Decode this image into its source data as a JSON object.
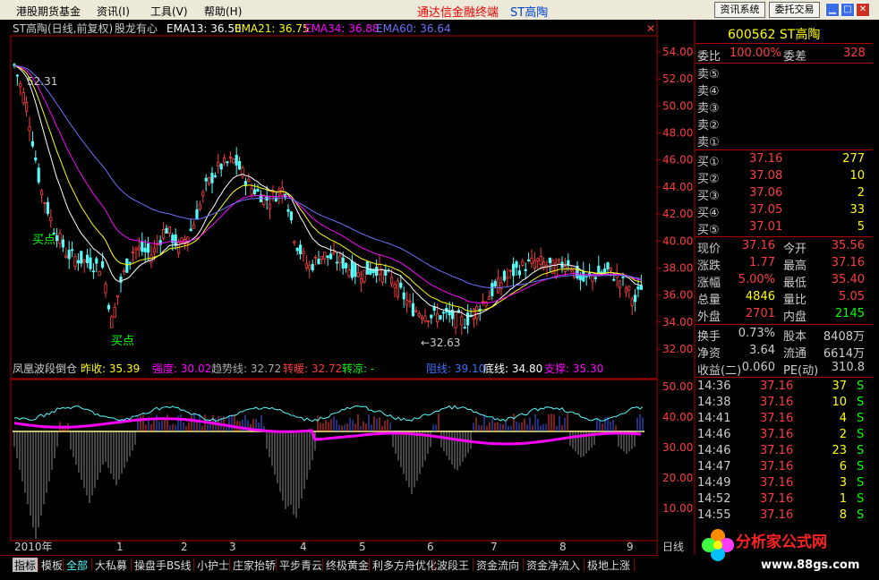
{
  "menu": {
    "items": [
      "港股期货基金",
      "资讯(I)",
      "工具(V)",
      "帮助(H)"
    ],
    "title": "通达信金融终端",
    "stock_title": "ST高陶",
    "btn_news": "资讯系统",
    "btn_trade": "委托交易"
  },
  "main_chart": {
    "header_name": "ST高陶(日线,前复权)",
    "indicator_name": "股龙有心",
    "ema13": "EMA13: 36.50",
    "ema21": "EMA21: 36.75",
    "ema34": "EMA34: 36.88",
    "ema60": "EMA60: 36.64",
    "high_label": "52.31",
    "low_label": "←32.63",
    "buy_label": "买点",
    "price_ticks": [
      "54.00",
      "52.00",
      "50.00",
      "48.00",
      "46.00",
      "44.00",
      "42.00",
      "40.00",
      "38.00",
      "36.00",
      "34.00",
      "32.00"
    ]
  },
  "sub_chart": {
    "name": "凤凰波段倒仓",
    "prev_close": "昨收: 35.39",
    "strength": "强度: 30.02",
    "trend": "趋势线: 32.72",
    "warm": "转暖: 32.72",
    "cool": "转凉: -",
    "pressure": "阻线: 39.10",
    "bottom": "底线: 34.80",
    "support": "支撑: 35.30",
    "ticks": [
      "50.00",
      "40.00",
      "30.00",
      "20.00",
      "10.00"
    ]
  },
  "time_axis": {
    "year": "2010年",
    "months": [
      "1",
      "2",
      "3",
      "4",
      "5",
      "6",
      "7",
      "8",
      "9"
    ],
    "period": "日线"
  },
  "quote": {
    "code_name": "600562 ST高陶",
    "weibi_label": "委比",
    "weibi": "100.00%",
    "weicha_label": "委差",
    "weicha": "328",
    "sells": [
      "卖⑤",
      "卖④",
      "卖③",
      "卖②",
      "卖①"
    ],
    "buys": [
      {
        "label": "买①",
        "price": "37.16",
        "vol": "277"
      },
      {
        "label": "买②",
        "price": "37.08",
        "vol": "10"
      },
      {
        "label": "买③",
        "price": "37.06",
        "vol": "2"
      },
      {
        "label": "买④",
        "price": "37.05",
        "vol": "33"
      },
      {
        "label": "买⑤",
        "price": "37.01",
        "vol": "5"
      }
    ],
    "stats": [
      {
        "l1": "现价",
        "v1": "37.16",
        "l2": "今开",
        "v2": "35.56"
      },
      {
        "l1": "涨跌",
        "v1": "1.77",
        "l2": "最高",
        "v2": "37.16"
      },
      {
        "l1": "涨幅",
        "v1": "5.00%",
        "l2": "最低",
        "v2": "35.40"
      },
      {
        "l1": "总量",
        "v1": "4846",
        "l2": "量比",
        "v2": "5.05"
      },
      {
        "l1": "外盘",
        "v1": "2701",
        "l2": "内盘",
        "v2": "2145"
      }
    ],
    "fund": [
      {
        "l1": "换手",
        "v1": "0.73%",
        "l2": "股本",
        "v2": "8408万"
      },
      {
        "l1": "净资",
        "v1": "3.64",
        "l2": "流通",
        "v2": "6614万"
      },
      {
        "l1": "收益(二)",
        "v1": "0.060",
        "l2": "PE(动)",
        "v2": "310.8"
      }
    ],
    "ticks": [
      {
        "t": "14:36",
        "p": "37.16",
        "v": "37",
        "s": "S"
      },
      {
        "t": "14:38",
        "p": "37.16",
        "v": "10",
        "s": "S"
      },
      {
        "t": "14:41",
        "p": "37.16",
        "v": "4",
        "s": "S"
      },
      {
        "t": "14:46",
        "p": "37.16",
        "v": "2",
        "s": "S"
      },
      {
        "t": "14:46",
        "p": "37.16",
        "v": "23",
        "s": "S"
      },
      {
        "t": "14:47",
        "p": "37.16",
        "v": "6",
        "s": "S"
      },
      {
        "t": "14:49",
        "p": "37.16",
        "v": "3",
        "s": "S"
      },
      {
        "t": "14:52",
        "p": "37.16",
        "v": "1",
        "s": "S"
      },
      {
        "t": "14:55",
        "p": "37.16",
        "v": "8",
        "s": "S"
      }
    ]
  },
  "tabs": [
    "指标",
    "模板",
    "全部",
    "大私募",
    "操盘手BS线",
    "小护士",
    "庄家抬轿",
    "平步青云",
    "终极黄金",
    "利多方舟优化",
    "波段王",
    "资金流向",
    "资金净流入",
    "极地上涨"
  ],
  "logo": {
    "text": "分析家公式网",
    "url": "www.88gs.com"
  },
  "colors": {
    "up": "#ff3c3c",
    "down": "#54fcfc",
    "ema13": "#ffffff",
    "ema21": "#ffff00",
    "ema34": "#ff00ff",
    "ema60": "#7070ff",
    "border": "#b00000"
  }
}
